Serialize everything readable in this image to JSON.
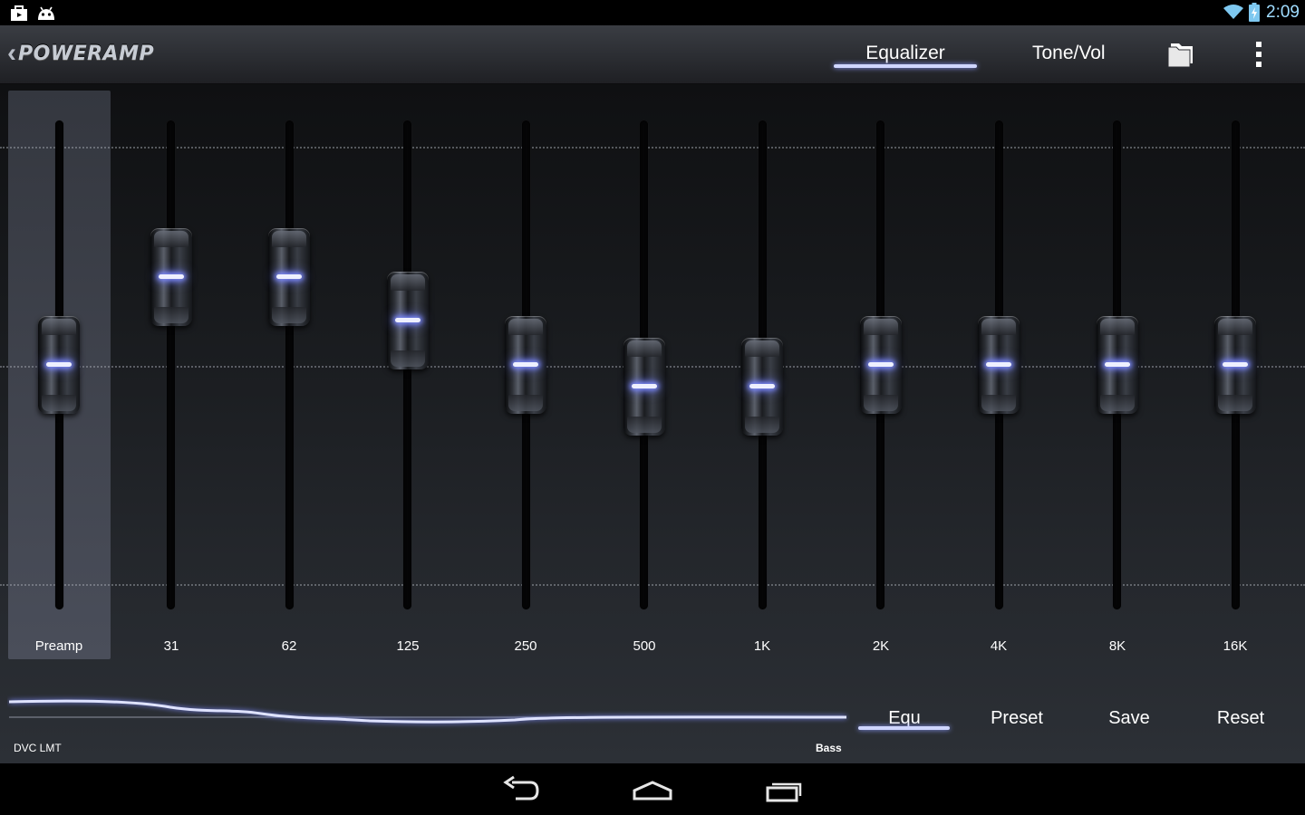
{
  "status_bar": {
    "time": "2:09",
    "icons": [
      "shopping-bag-icon",
      "android-icon",
      "wifi-icon",
      "battery-icon"
    ]
  },
  "app_bar": {
    "logo_text": "POWERAMP",
    "tabs": [
      {
        "label": "Equalizer",
        "selected": true
      },
      {
        "label": "Tone/Vol",
        "selected": false
      }
    ],
    "icons": [
      "back-chevron-icon",
      "folder-icon",
      "overflow-menu-icon"
    ]
  },
  "equalizer": {
    "preamp_label": "Preamp",
    "bands": [
      {
        "label": "31"
      },
      {
        "label": "62"
      },
      {
        "label": "125"
      },
      {
        "label": "250"
      },
      {
        "label": "500"
      },
      {
        "label": "1K"
      },
      {
        "label": "2K"
      },
      {
        "label": "4K"
      },
      {
        "label": "8K"
      },
      {
        "label": "16K"
      }
    ],
    "slider_levels": {
      "preamp": 0.5,
      "bands": [
        0.68,
        0.68,
        0.59,
        0.5,
        0.455,
        0.455,
        0.5,
        0.5,
        0.5,
        0.5
      ]
    }
  },
  "bottom": {
    "dvc_label": "DVC LMT",
    "bass_label": "Bass",
    "buttons": [
      {
        "label": "Equ",
        "selected": true
      },
      {
        "label": "Preset",
        "selected": false
      },
      {
        "label": "Save",
        "selected": false
      },
      {
        "label": "Reset",
        "selected": false
      }
    ]
  },
  "nav_bar": {
    "icons": [
      "back-icon",
      "home-icon",
      "recent-apps-icon"
    ]
  },
  "colors": {
    "accent": "#cfd6ff",
    "glow": "#7e8cff",
    "status_time": "#9fdcff"
  }
}
